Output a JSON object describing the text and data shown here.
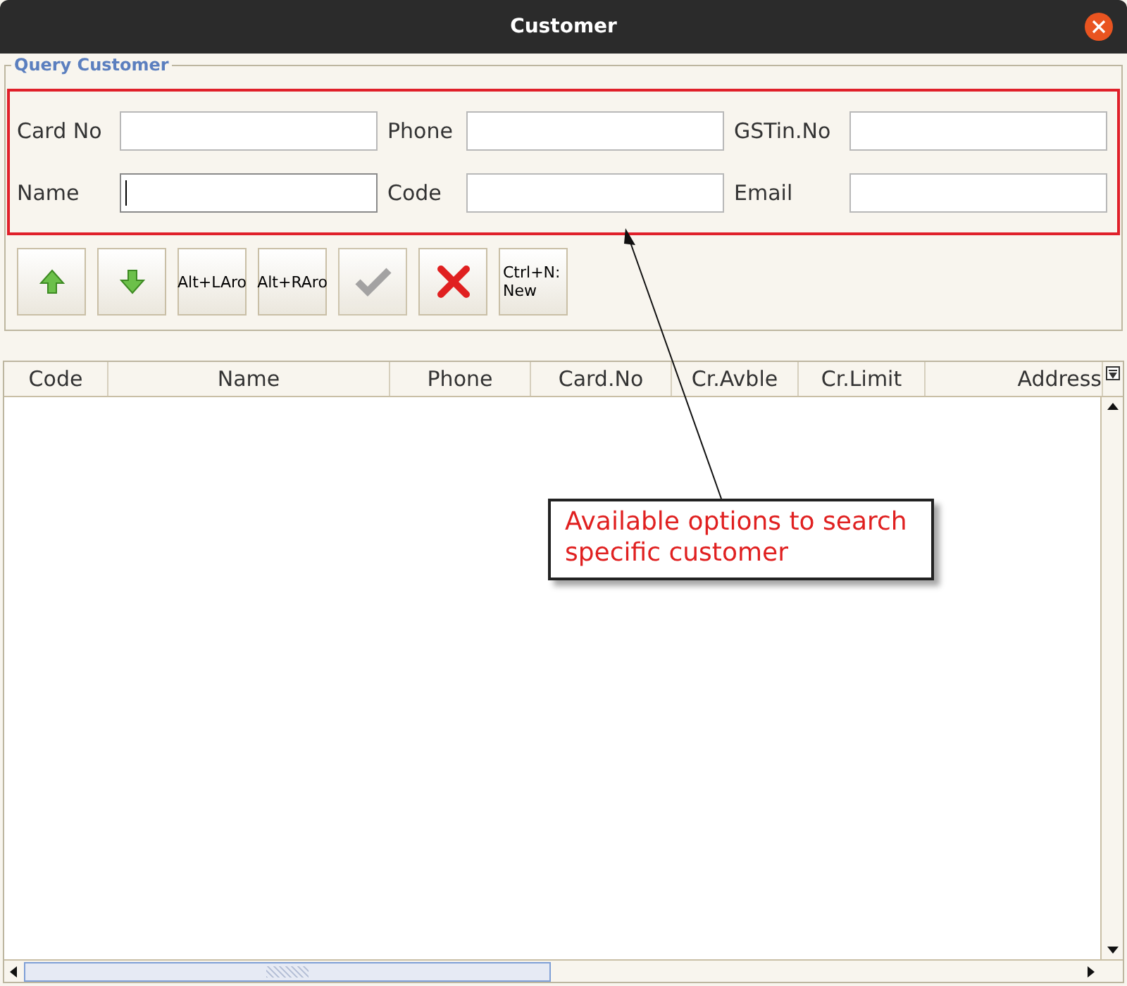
{
  "window": {
    "title": "Customer"
  },
  "query": {
    "title": "Query Customer",
    "fields": [
      {
        "label": "Card No",
        "focused": false
      },
      {
        "label": "Phone",
        "focused": false
      },
      {
        "label": "GSTin.No",
        "focused": false
      },
      {
        "label": "Name",
        "focused": true
      },
      {
        "label": "Code",
        "focused": false
      },
      {
        "label": "Email",
        "focused": false
      }
    ]
  },
  "toolbar": [
    {
      "kind": "up",
      "disabled": false
    },
    {
      "kind": "down",
      "disabled": false
    },
    {
      "kind": "text",
      "label": "Alt+LAro",
      "disabled": false
    },
    {
      "kind": "text",
      "label": "Alt+RAro",
      "disabled": false
    },
    {
      "kind": "check",
      "disabled": true
    },
    {
      "kind": "cross",
      "disabled": false
    },
    {
      "kind": "text",
      "label": "Ctrl+N: New",
      "disabled": false
    }
  ],
  "table": {
    "columns": [
      "Code",
      "Name",
      "Phone",
      "Card.No",
      "Cr.Avble",
      "Cr.Limit",
      "Address"
    ]
  },
  "annotation": {
    "text": "Available options to search specific customer"
  }
}
